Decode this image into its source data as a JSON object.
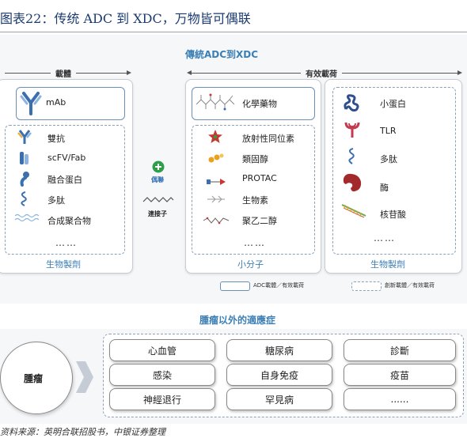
{
  "figure_title": "图表22：传统 ADC 到 XDC，万物皆可偶联",
  "diagram": {
    "top_title": "傳統ADC到XDC",
    "carrier_header": "載體",
    "payload_header": "有效載荷",
    "carrier": {
      "primary": "mAb",
      "items": [
        "雙抗",
        "scFV/Fab",
        "融合蛋白",
        "多肽",
        "合成聚合物"
      ],
      "more": "……",
      "footer": "生物製劑"
    },
    "conjugation": {
      "label": "偶聯",
      "linker_label": "連接子"
    },
    "small_molecule": {
      "primary": "化學藥物",
      "items": [
        "放射性同位素",
        "類固醇",
        "PROTAC",
        "生物素",
        "聚乙二醇"
      ],
      "more": "……",
      "footer": "小分子"
    },
    "biologic_payload": {
      "items": [
        "小蛋白",
        "TLR",
        "多肽",
        "酶",
        "核苷酸"
      ],
      "more": "……",
      "footer": "生物製劑"
    },
    "legend": {
      "solid": "ADC載體／有效載荷",
      "dashed": "創新載體／有效載荷"
    },
    "indications_title": "腫瘤以外的適應症",
    "tumor_label": "腫瘤",
    "indications": [
      [
        "心血管",
        "糖尿病",
        "診斷"
      ],
      [
        "感染",
        "自身免疫",
        "疫苗"
      ],
      [
        "神經退行",
        "罕見病",
        "......"
      ]
    ]
  },
  "source_line": "资料来源：英明合联招股书，中银证券整理"
}
